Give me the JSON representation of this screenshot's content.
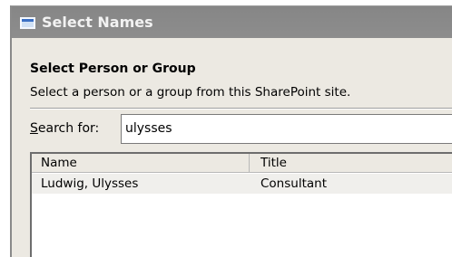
{
  "window": {
    "title": "Select Names"
  },
  "heading": "Select Person or Group",
  "description": "Select a person or a group from this SharePoint site.",
  "search": {
    "label_accel": "S",
    "label_rest": "earch for:",
    "value": "ulysses"
  },
  "results": {
    "columns": [
      "Name",
      "Title"
    ],
    "rows": [
      {
        "name": "Ludwig, Ulysses",
        "title": "Consultant"
      }
    ]
  },
  "colors": {
    "titlebar": "#8a8a8a",
    "dialog_bg": "#ece9e2",
    "selected_row": "#f0efec"
  }
}
